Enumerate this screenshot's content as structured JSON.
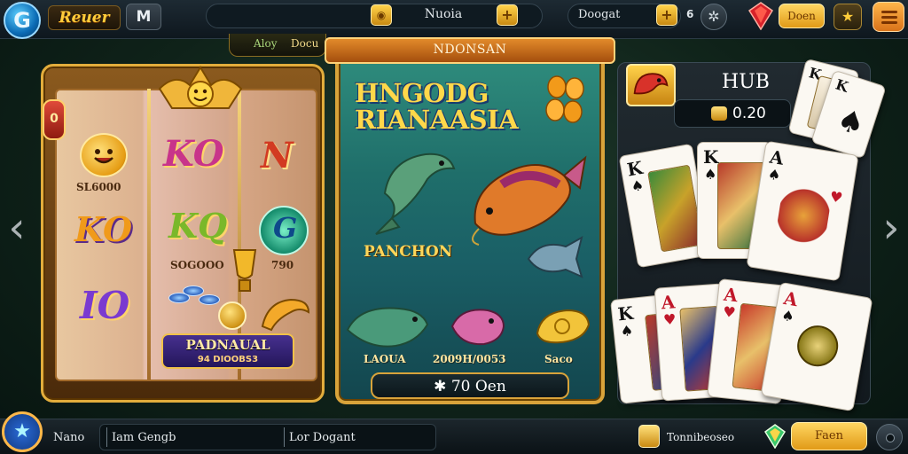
{
  "topbar": {
    "logo_letter": "G",
    "brand": "Reuer",
    "m_label": "M",
    "search_label": "Nuoia",
    "search_coin_icon": "coin-icon",
    "search_plus": "+",
    "balance_label": "Doogat",
    "balance_plus": "+",
    "count": "6",
    "yellow_button": "Doen",
    "star_icon": "★"
  },
  "subtabs": {
    "a": "Aloy",
    "b": "Docu"
  },
  "nav": {
    "left": "‹",
    "right": "›"
  },
  "slots": {
    "red_pill": "0",
    "sym_ko1": "KO",
    "sym_n": "N",
    "sym_ko2": "KO",
    "sym_kq": "KQ",
    "sym_g": "G",
    "sym_io": "IO",
    "caption_1": "SL6000",
    "caption_2": "SOGOOO",
    "caption_3": "790",
    "banner_title": "PADNAUAL",
    "banner_sub": "94 DIOOBS3"
  },
  "fish": {
    "header": "NDONSAN",
    "title_line1": "HNGODG",
    "title_line2": "RIANAASIA",
    "panchon": "PANCHON",
    "label_1": "LAOUA",
    "label_2": "2009H/0053",
    "label_3": "Saco",
    "footer": "✱ 70 Oen"
  },
  "cards": {
    "hub_title": "HUB",
    "hub_value": "0.20",
    "ranks": [
      "K",
      "K",
      "K",
      "A",
      "K",
      "A",
      "K",
      "A"
    ]
  },
  "bottombar": {
    "avatar_icon": "★",
    "label_1": "Nano",
    "label_2": "Iam Gengb",
    "label_3": "Lor Dogant",
    "coin_text": "Tonnibeoseo",
    "yellow_button": "Faen"
  },
  "colors": {
    "accent_gold": "#f0c14a",
    "panel_teal": "#1f6e6a",
    "bar_dark": "#0e171e"
  }
}
